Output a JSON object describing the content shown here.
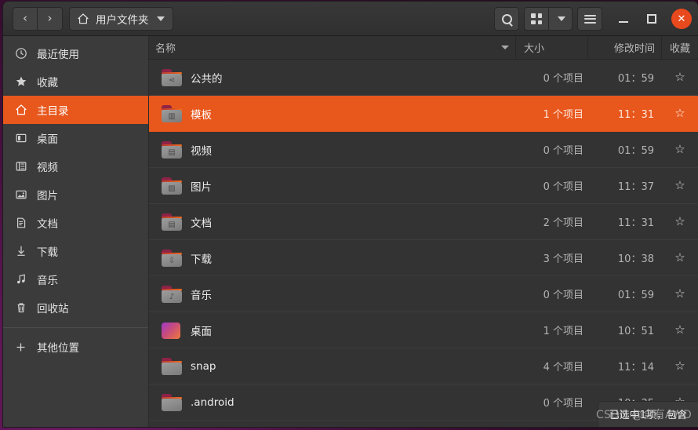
{
  "window": {
    "title": "用户文件夹",
    "nav": {
      "back": "‹",
      "forward": "›"
    },
    "path_icon": "home-icon",
    "controls": {
      "minimize": "—",
      "maximize": "□",
      "close": "✕"
    },
    "toolbar": {
      "search": "search-icon",
      "grid_view": "grid-view-icon",
      "view_dropdown": "chevron-down-icon",
      "menu": "hamburger-menu-icon"
    }
  },
  "sidebar": {
    "items": [
      {
        "label": "最近使用",
        "icon": "clock-icon",
        "glyph": "🕐",
        "active": false
      },
      {
        "label": "收藏",
        "icon": "star-icon",
        "glyph": "★",
        "active": false
      },
      {
        "label": "主目录",
        "icon": "home-icon",
        "glyph": "⌂",
        "active": true
      },
      {
        "label": "桌面",
        "icon": "desktop-icon",
        "glyph": "▢",
        "active": false
      },
      {
        "label": "视频",
        "icon": "video-icon",
        "glyph": "▤",
        "active": false
      },
      {
        "label": "图片",
        "icon": "image-icon",
        "glyph": "▨",
        "active": false
      },
      {
        "label": "文档",
        "icon": "document-icon",
        "glyph": "▤",
        "active": false
      },
      {
        "label": "下载",
        "icon": "download-icon",
        "glyph": "⇩",
        "active": false
      },
      {
        "label": "音乐",
        "icon": "music-icon",
        "glyph": "♫",
        "active": false
      },
      {
        "label": "回收站",
        "icon": "trash-icon",
        "glyph": "🗑",
        "active": false
      }
    ],
    "other_locations": {
      "label": "其他位置",
      "icon": "plus-icon",
      "glyph": "+"
    }
  },
  "filelist": {
    "columns": [
      {
        "key": "name",
        "label": "名称",
        "sorted": true,
        "sort_dir": "desc"
      },
      {
        "key": "size",
        "label": "大小"
      },
      {
        "key": "time",
        "label": "修改时间"
      },
      {
        "key": "star",
        "label": "收藏"
      }
    ],
    "rows": [
      {
        "name": "公共的",
        "size": "0 个项目",
        "time": "01：59",
        "star": "☆",
        "icon": "folder-share-icon",
        "emb": "⋖",
        "style": "plain",
        "selected": false
      },
      {
        "name": "模板",
        "size": "1 个项目",
        "time": "11：31",
        "star": "☆",
        "icon": "folder-templates-icon",
        "emb": "▥",
        "style": "plain",
        "selected": true
      },
      {
        "name": "视频",
        "size": "0 个项目",
        "time": "01：59",
        "star": "☆",
        "icon": "folder-videos-icon",
        "emb": "▤",
        "style": "plain",
        "selected": false
      },
      {
        "name": "图片",
        "size": "0 个项目",
        "time": "11：37",
        "star": "☆",
        "icon": "folder-pictures-icon",
        "emb": "▨",
        "style": "plain",
        "selected": false
      },
      {
        "name": "文档",
        "size": "2 个项目",
        "time": "11：31",
        "star": "☆",
        "icon": "folder-documents-icon",
        "emb": "▤",
        "style": "plain",
        "selected": false
      },
      {
        "name": "下载",
        "size": "3 个项目",
        "time": "10：38",
        "star": "☆",
        "icon": "folder-download-icon",
        "emb": "⇩",
        "style": "plain",
        "selected": false
      },
      {
        "name": "音乐",
        "size": "0 个项目",
        "time": "01：59",
        "star": "☆",
        "icon": "folder-music-icon",
        "emb": "♪",
        "style": "plain",
        "selected": false
      },
      {
        "name": "桌面",
        "size": "1 个项目",
        "time": "10：51",
        "star": "☆",
        "icon": "folder-desktop-icon",
        "emb": "",
        "style": "gradient",
        "selected": false
      },
      {
        "name": "snap",
        "size": "4 个项目",
        "time": "11：14",
        "star": "☆",
        "icon": "folder-icon",
        "emb": "",
        "style": "empty",
        "selected": false
      },
      {
        "name": ".android",
        "size": "0 个项目",
        "time": "10：35",
        "star": "☆",
        "icon": "folder-icon",
        "emb": "",
        "style": "empty",
        "selected": false
      }
    ]
  },
  "status": {
    "text": "已选中1项，包含"
  },
  "watermark": {
    "text": "CSDN @含有AWD"
  },
  "colors": {
    "accent": "#e8571c",
    "window_bg": "#353535",
    "sidebar_bg": "#3b3b3b",
    "list_bg": "#333333",
    "close_button": "#e8491d"
  }
}
